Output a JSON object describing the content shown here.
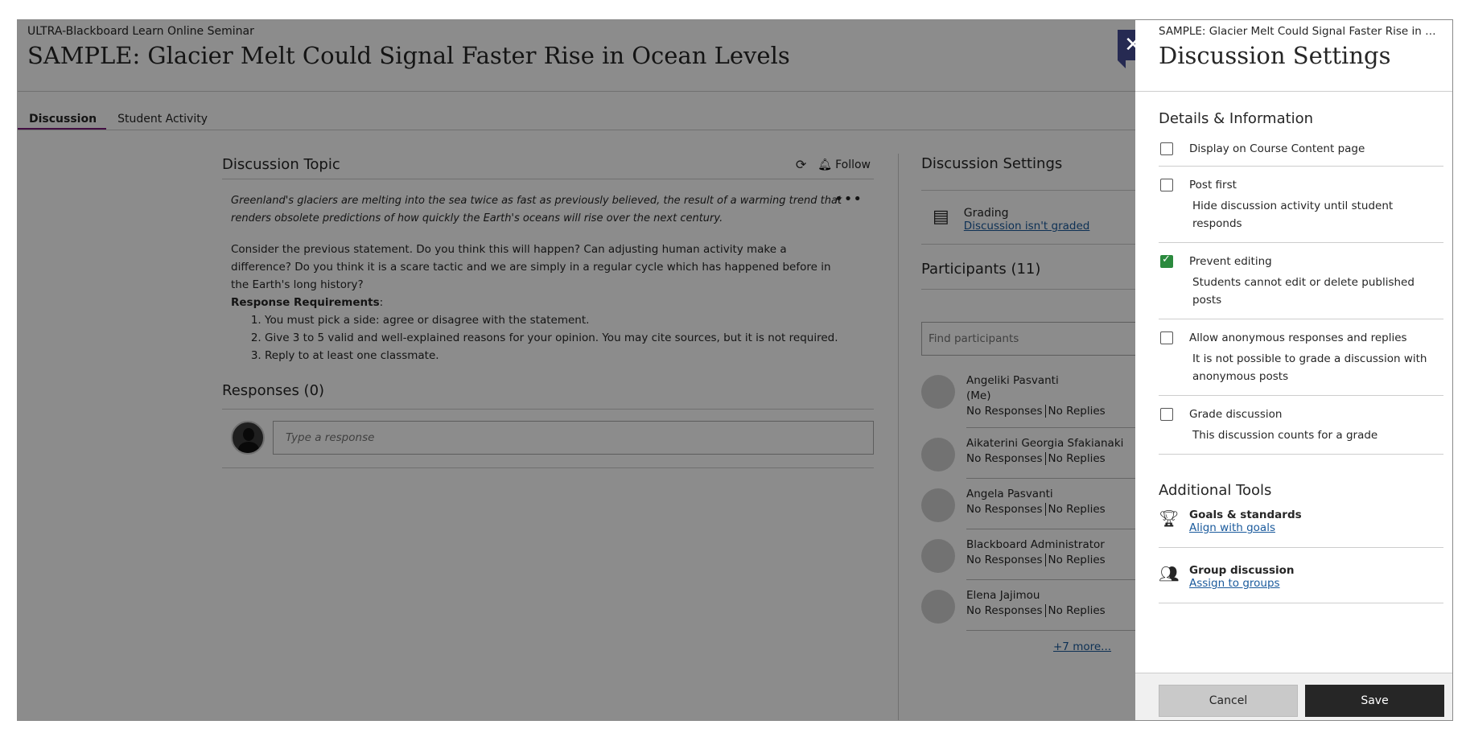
{
  "course_name": "ULTRA-Blackboard Learn Online Seminar",
  "page_title": "SAMPLE: Glacier Melt Could Signal Faster Rise in Ocean Levels",
  "tabs": [
    {
      "label": "Discussion"
    },
    {
      "label": "Student Activity"
    }
  ],
  "topic": {
    "title": "Discussion Topic",
    "follow_label": "Follow",
    "intro": "Greenland's glaciers are melting into the sea twice as fast as previously believed, the result of a warming trend that renders obsolete predictions of how quickly the Earth's oceans will rise over the next century.",
    "body": " Consider the previous statement. Do you think this will happen? Can adjusting human activity make a difference? Do you think it is a scare tactic and we are simply in a regular cycle which has happened before in the Earth's long history?",
    "requirements_label": "Response Requirements",
    "requirements_colon": ":",
    "requirements": [
      "You must pick a side: agree or disagree with the statement.",
      "Give 3 to 5 valid and well-explained reasons for your opinion. You may cite sources, but it is not required.",
      "Reply to at least one classmate."
    ]
  },
  "responses": {
    "title": "Responses (0)",
    "placeholder": "Type a response"
  },
  "sidebar": {
    "settings_title": "Discussion Settings",
    "grading_label": "Grading",
    "grading_link": "Discussion isn't graded",
    "participants_title": "Participants (11)",
    "find_placeholder": "Find participants",
    "participants": [
      {
        "name": "Angeliki Pasvanti",
        "me": "(Me)",
        "responses": "No Responses",
        "replies": "No Replies"
      },
      {
        "name": "Aikaterini Georgia Sfakianaki",
        "responses": "No Responses",
        "replies": "No Replies"
      },
      {
        "name": "Angela Pasvanti",
        "responses": "No Responses",
        "replies": "No Replies"
      },
      {
        "name": "Blackboard Administrator",
        "responses": "No Responses",
        "replies": "No Replies"
      },
      {
        "name": "Elena Jajimou",
        "responses": "No Responses",
        "replies": "No Replies"
      }
    ],
    "more_link": "+7 more..."
  },
  "panel": {
    "breadcrumb": "SAMPLE: Glacier Melt Could Signal Faster Rise in Oce...",
    "title": "Discussion Settings",
    "details_title": "Details & Information",
    "options": [
      {
        "label": "Display on Course Content page",
        "desc": "",
        "checked": false
      },
      {
        "label": "Post first",
        "desc": "Hide discussion activity until student responds",
        "checked": false
      },
      {
        "label": "Prevent editing",
        "desc": "Students cannot edit or delete published posts",
        "checked": true
      },
      {
        "label": "Allow anonymous responses and replies",
        "desc": "It is not possible to grade a discussion with anonymous posts",
        "checked": false
      },
      {
        "label": "Grade discussion",
        "desc": "This discussion counts for a grade",
        "checked": false
      }
    ],
    "tools_title": "Additional Tools",
    "tools": [
      {
        "label": "Goals & standards",
        "link": "Align with goals",
        "icon": "trophy-icon"
      },
      {
        "label": "Group discussion",
        "link": "Assign to groups",
        "icon": "group-icon"
      }
    ],
    "cancel_label": "Cancel",
    "save_label": "Save"
  },
  "colors": {
    "accent_tab": "#7a1c7a",
    "close_button": "#262a52",
    "link": "#1a5a9c",
    "checked": "#2b8a3e",
    "save_button": "#262626"
  }
}
